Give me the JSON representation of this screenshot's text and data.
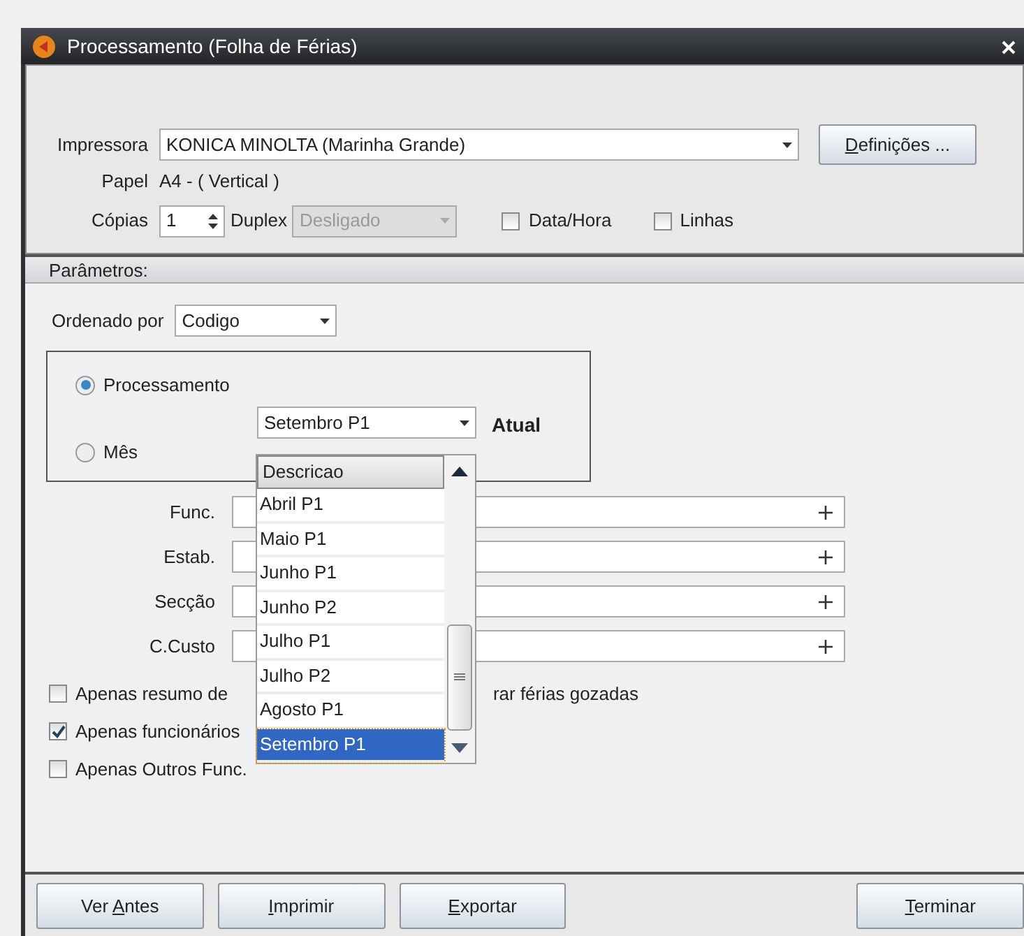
{
  "window": {
    "title": "Processamento (Folha de Férias)"
  },
  "printer": {
    "label": "Impressora",
    "value": "KONICA MINOLTA (Marinha Grande)",
    "settings_button": {
      "accelerator": "D",
      "label_after": "efinições ..."
    }
  },
  "paper": {
    "label": "Papel",
    "value": "A4 - ( Vertical )"
  },
  "copies": {
    "label": "Cópias",
    "value": "1"
  },
  "duplex": {
    "label": "Duplex",
    "value": "Desligado",
    "disabled": true
  },
  "print_options": [
    {
      "label": "Data/Hora",
      "checked": false
    },
    {
      "label": "Linhas",
      "checked": false
    }
  ],
  "parameters": {
    "title": "Parâmetros:",
    "order_by": {
      "label": "Ordenado por",
      "value": "Codigo"
    },
    "period": {
      "options": [
        {
          "label": "Processamento",
          "selected": true
        },
        {
          "label": "Mês",
          "selected": false
        }
      ],
      "month_select": {
        "value": "Setembro P1"
      },
      "current_label": "Atual"
    },
    "filters": [
      {
        "label": "Func."
      },
      {
        "label": "Estab."
      },
      {
        "label": "Secção"
      },
      {
        "label": "C.Custo"
      }
    ],
    "checkboxes": [
      {
        "label": "Apenas resumo de",
        "label_tail": "rar férias gozadas",
        "checked": false
      },
      {
        "label": "Apenas funcionários",
        "checked": true
      },
      {
        "label": "Apenas Outros Func.",
        "checked": false
      }
    ],
    "dropdown": {
      "header": "Descricao",
      "items": [
        {
          "label": "Abril P1",
          "selected": false
        },
        {
          "label": "Maio P1",
          "selected": false
        },
        {
          "label": "Junho P1",
          "selected": false
        },
        {
          "label": "Junho P2",
          "selected": false
        },
        {
          "label": "Julho P1",
          "selected": false
        },
        {
          "label": "Julho P2",
          "selected": false
        },
        {
          "label": "Agosto P1",
          "selected": false
        },
        {
          "label": "Setembro P1",
          "selected": true
        }
      ]
    }
  },
  "buttons": [
    {
      "label_before": "Ver ",
      "accelerator": "A",
      "label_after": "ntes"
    },
    {
      "accelerator": "I",
      "label_after": "mprimir"
    },
    {
      "accelerator": "E",
      "label_after": "xportar"
    },
    {
      "accelerator": "T",
      "label_after": "erminar"
    }
  ]
}
